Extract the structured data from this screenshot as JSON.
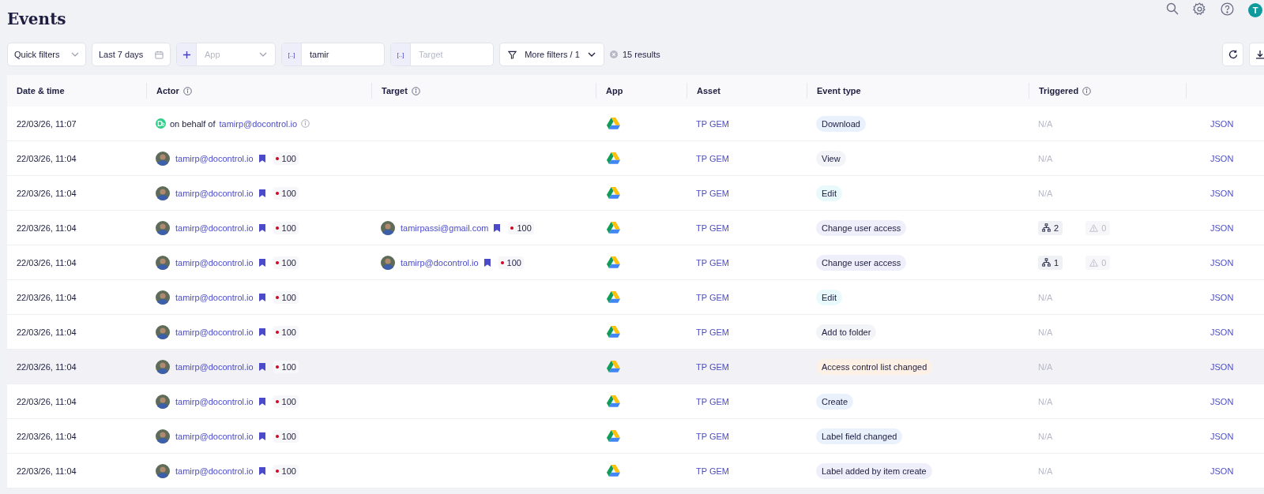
{
  "page": {
    "title": "Events",
    "avatar_initial": "T"
  },
  "filters": [
    {
      "kind": "dropdown",
      "label": "Quick filters"
    },
    {
      "kind": "date",
      "label": "Last 7 days"
    },
    {
      "kind": "app",
      "placeholder": "App"
    },
    {
      "kind": "text",
      "prefix": "[..]",
      "value": "tamir"
    },
    {
      "kind": "text",
      "prefix": "[..]",
      "placeholder": "Target"
    },
    {
      "kind": "more",
      "label": "More filters / 1"
    }
  ],
  "results": "15 results",
  "table": {
    "columns": [
      {
        "label": "Date & time",
        "info": false
      },
      {
        "label": "Actor",
        "info": true
      },
      {
        "label": "Target",
        "info": true
      },
      {
        "label": "App",
        "info": false
      },
      {
        "label": "Asset",
        "info": false
      },
      {
        "label": "Event type",
        "info": false
      },
      {
        "label": "Triggered",
        "info": true
      }
    ],
    "rows": [
      {
        "date": "22/03/26, 11:07",
        "hovered": false,
        "actor": {
          "kind": "on_behalf",
          "prefix": "on behalf of",
          "email": "tamirp@docontrol.io"
        },
        "asset": "TP GEM",
        "event_type": {
          "label": "Download",
          "color": "#e9f1fd"
        },
        "triggered": {
          "kind": "na",
          "text": "N/A"
        },
        "link": "JSON"
      },
      {
        "date": "22/03/26, 11:04",
        "hovered": false,
        "actor": {
          "kind": "user",
          "email": "tamirp@docontrol.io",
          "score": "100"
        },
        "asset": "TP GEM",
        "event_type": {
          "label": "View",
          "color": "#f3f4f7"
        },
        "triggered": {
          "kind": "na",
          "text": "N/A"
        },
        "link": "JSON"
      },
      {
        "date": "22/03/26, 11:04",
        "hovered": false,
        "actor": {
          "kind": "user",
          "email": "tamirp@docontrol.io",
          "score": "100"
        },
        "asset": "TP GEM",
        "event_type": {
          "label": "Edit",
          "color": "#e8fafb"
        },
        "triggered": {
          "kind": "na",
          "text": "N/A"
        },
        "link": "JSON"
      },
      {
        "date": "22/03/26, 11:04",
        "hovered": false,
        "actor": {
          "kind": "user",
          "email": "tamirp@docontrol.io",
          "score": "100"
        },
        "target": {
          "email": "tamirpassi@gmail.com",
          "score": "100"
        },
        "asset": "TP GEM",
        "event_type": {
          "label": "Change user access",
          "color": "#efeefb"
        },
        "triggered": {
          "kind": "counts",
          "affected": "2",
          "alerts": "0"
        },
        "link": "JSON"
      },
      {
        "date": "22/03/26, 11:04",
        "hovered": false,
        "actor": {
          "kind": "user",
          "email": "tamirp@docontrol.io",
          "score": "100"
        },
        "target": {
          "email": "tamirp@docontrol.io",
          "score": "100"
        },
        "asset": "TP GEM",
        "event_type": {
          "label": "Change user access",
          "color": "#efeefb"
        },
        "triggered": {
          "kind": "counts",
          "affected": "1",
          "alerts": "0"
        },
        "link": "JSON"
      },
      {
        "date": "22/03/26, 11:04",
        "hovered": false,
        "actor": {
          "kind": "user",
          "email": "tamirp@docontrol.io",
          "score": "100"
        },
        "asset": "TP GEM",
        "event_type": {
          "label": "Edit",
          "color": "#e8fafb"
        },
        "triggered": {
          "kind": "na",
          "text": "N/A"
        },
        "link": "JSON"
      },
      {
        "date": "22/03/26, 11:04",
        "hovered": false,
        "actor": {
          "kind": "user",
          "email": "tamirp@docontrol.io",
          "score": "100"
        },
        "asset": "TP GEM",
        "event_type": {
          "label": "Add to folder",
          "color": "#f3f4f7"
        },
        "triggered": {
          "kind": "na",
          "text": "N/A"
        },
        "link": "JSON"
      },
      {
        "date": "22/03/26, 11:04",
        "hovered": true,
        "actor": {
          "kind": "user",
          "email": "tamirp@docontrol.io",
          "score": "100"
        },
        "asset": "TP GEM",
        "event_type": {
          "label": "Access control list changed",
          "color": "#fdf1e6"
        },
        "triggered": {
          "kind": "na",
          "text": "N/A"
        },
        "link": "JSON"
      },
      {
        "date": "22/03/26, 11:04",
        "hovered": false,
        "actor": {
          "kind": "user",
          "email": "tamirp@docontrol.io",
          "score": "100"
        },
        "asset": "TP GEM",
        "event_type": {
          "label": "Create",
          "color": "#e9f1fd"
        },
        "triggered": {
          "kind": "na",
          "text": "N/A"
        },
        "link": "JSON"
      },
      {
        "date": "22/03/26, 11:04",
        "hovered": false,
        "actor": {
          "kind": "user",
          "email": "tamirp@docontrol.io",
          "score": "100"
        },
        "asset": "TP GEM",
        "event_type": {
          "label": "Label field changed",
          "color": "#e9f1fd"
        },
        "triggered": {
          "kind": "na",
          "text": "N/A"
        },
        "link": "JSON"
      },
      {
        "date": "22/03/26, 11:04",
        "hovered": false,
        "actor": {
          "kind": "user",
          "email": "tamirp@docontrol.io",
          "score": "100"
        },
        "asset": "TP GEM",
        "event_type": {
          "label": "Label added by item create",
          "color": "#efeefb"
        },
        "triggered": {
          "kind": "na",
          "text": "N/A"
        },
        "link": "JSON"
      }
    ]
  }
}
